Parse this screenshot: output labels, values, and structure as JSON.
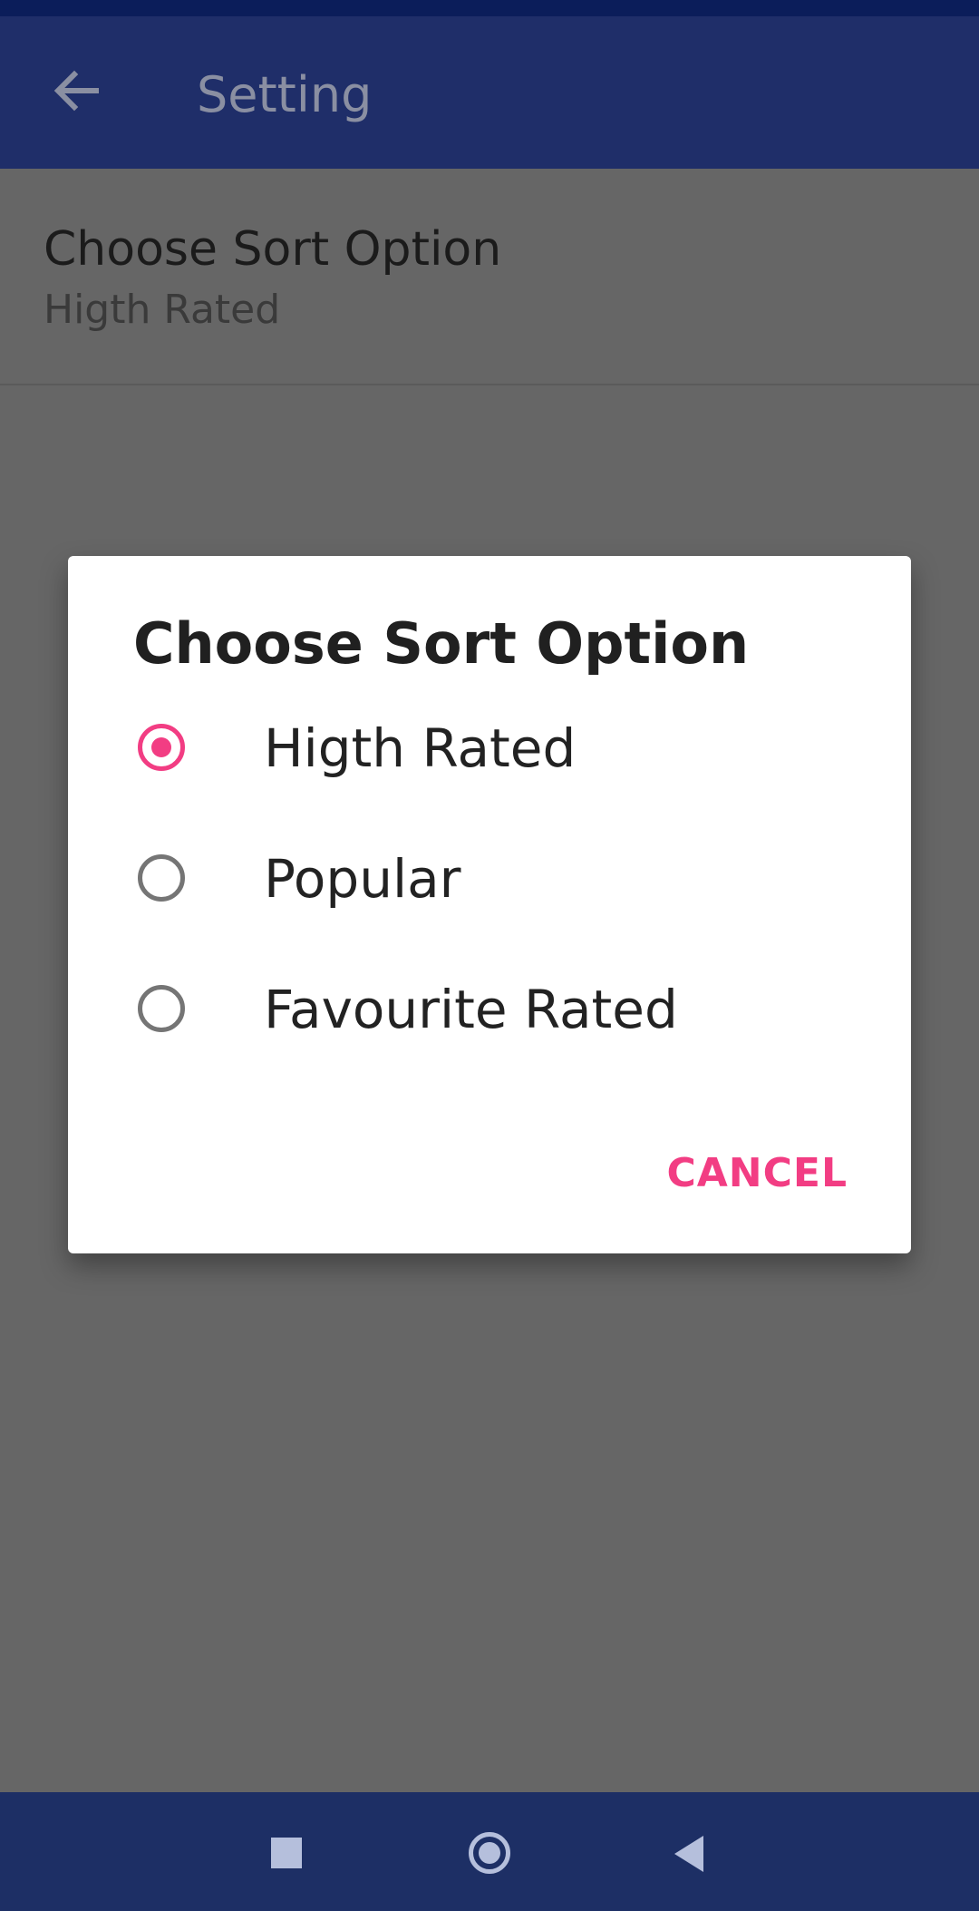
{
  "app_bar": {
    "title": "Setting",
    "back_icon": "arrow-back-icon"
  },
  "preference": {
    "title": "Choose Sort Option",
    "summary": "Higth Rated"
  },
  "dialog": {
    "title": "Choose Sort Option",
    "options": [
      {
        "label": "Higth Rated",
        "checked": true
      },
      {
        "label": "Popular",
        "checked": false
      },
      {
        "label": "Favourite Rated",
        "checked": false
      }
    ],
    "cancel_label": "CANCEL"
  },
  "nav_bar": {
    "recent_icon": "square-icon",
    "home_icon": "circle-icon",
    "back_icon": "triangle-back-icon"
  },
  "colors": {
    "accent": "#f23d83",
    "app_bar": "#1f2e69",
    "scrim": "#666666"
  }
}
